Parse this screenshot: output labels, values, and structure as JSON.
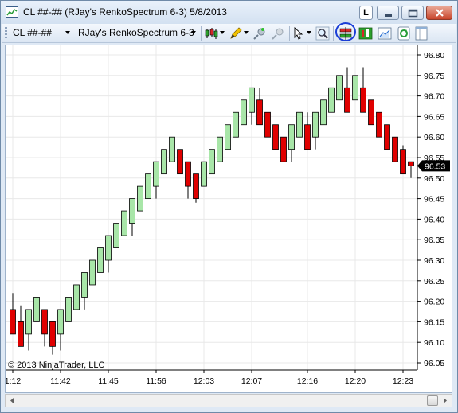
{
  "window": {
    "title": "CL ##-## (RJay's RenkoSpectrum 6-3)  5/8/2013",
    "lock_label": "L"
  },
  "toolbar": {
    "instrument": "CL ##-##",
    "chart_style": "RJay's RenkoSpectrum 6-3",
    "icons": [
      "candlestick-icon",
      "pencil-icon",
      "pin-icon",
      "magnet-icon",
      "cursor-icon",
      "zoom-icon",
      "bar-style-icon",
      "data-box-icon",
      "chart-properties-icon",
      "refresh-icon",
      "window-icon"
    ]
  },
  "copyright": "© 2013 NinjaTrader, LLC",
  "colors": {
    "up": "#a8e6a8",
    "down": "#e00000",
    "grid": "#e8e8e8",
    "circle": "#1a3dd6"
  },
  "chart_data": {
    "type": "candlestick",
    "price_tag": "96.53",
    "ylim": [
      96.05,
      96.82
    ],
    "yticks": [
      "96.80",
      "96.75",
      "96.70",
      "96.65",
      "96.60",
      "96.55",
      "96.50",
      "96.45",
      "96.40",
      "96.35",
      "96.30",
      "96.25",
      "96.20",
      "96.15",
      "96.10",
      "96.05"
    ],
    "xticks": [
      "1:12",
      "11:42",
      "11:45",
      "11:56",
      "12:03",
      "12:07",
      "12:16",
      "12:20",
      "12:23"
    ],
    "bars": [
      {
        "dir": "down",
        "open": 96.18,
        "close": 96.12,
        "high": 96.22,
        "low": 96.12
      },
      {
        "dir": "down",
        "open": 96.15,
        "close": 96.09,
        "high": 96.19,
        "low": 96.09
      },
      {
        "dir": "up",
        "open": 96.12,
        "close": 96.18,
        "high": 96.18,
        "low": 96.08
      },
      {
        "dir": "up",
        "open": 96.15,
        "close": 96.21,
        "high": 96.21,
        "low": 96.15
      },
      {
        "dir": "down",
        "open": 96.18,
        "close": 96.12,
        "high": 96.18,
        "low": 96.09
      },
      {
        "dir": "down",
        "open": 96.15,
        "close": 96.09,
        "high": 96.15,
        "low": 96.07
      },
      {
        "dir": "up",
        "open": 96.12,
        "close": 96.18,
        "high": 96.18,
        "low": 96.08
      },
      {
        "dir": "up",
        "open": 96.15,
        "close": 96.21,
        "high": 96.21,
        "low": 96.15
      },
      {
        "dir": "up",
        "open": 96.18,
        "close": 96.24,
        "high": 96.24,
        "low": 96.18
      },
      {
        "dir": "up",
        "open": 96.21,
        "close": 96.27,
        "high": 96.27,
        "low": 96.18
      },
      {
        "dir": "up",
        "open": 96.24,
        "close": 96.3,
        "high": 96.3,
        "low": 96.24
      },
      {
        "dir": "up",
        "open": 96.27,
        "close": 96.33,
        "high": 96.33,
        "low": 96.27
      },
      {
        "dir": "up",
        "open": 96.3,
        "close": 96.36,
        "high": 96.36,
        "low": 96.27
      },
      {
        "dir": "up",
        "open": 96.33,
        "close": 96.39,
        "high": 96.39,
        "low": 96.33
      },
      {
        "dir": "up",
        "open": 96.36,
        "close": 96.42,
        "high": 96.42,
        "low": 96.36
      },
      {
        "dir": "up",
        "open": 96.39,
        "close": 96.45,
        "high": 96.45,
        "low": 96.36
      },
      {
        "dir": "up",
        "open": 96.42,
        "close": 96.48,
        "high": 96.48,
        "low": 96.42
      },
      {
        "dir": "up",
        "open": 96.45,
        "close": 96.51,
        "high": 96.51,
        "low": 96.45
      },
      {
        "dir": "up",
        "open": 96.48,
        "close": 96.54,
        "high": 96.54,
        "low": 96.45
      },
      {
        "dir": "up",
        "open": 96.51,
        "close": 96.57,
        "high": 96.57,
        "low": 96.51
      },
      {
        "dir": "up",
        "open": 96.54,
        "close": 96.6,
        "high": 96.6,
        "low": 96.54
      },
      {
        "dir": "down",
        "open": 96.57,
        "close": 96.51,
        "high": 96.57,
        "low": 96.51
      },
      {
        "dir": "down",
        "open": 96.54,
        "close": 96.48,
        "high": 96.54,
        "low": 96.45
      },
      {
        "dir": "down",
        "open": 96.51,
        "close": 96.45,
        "high": 96.51,
        "low": 96.44
      },
      {
        "dir": "up",
        "open": 96.48,
        "close": 96.54,
        "high": 96.54,
        "low": 96.48
      },
      {
        "dir": "up",
        "open": 96.51,
        "close": 96.57,
        "high": 96.57,
        "low": 96.51
      },
      {
        "dir": "up",
        "open": 96.54,
        "close": 96.6,
        "high": 96.6,
        "low": 96.54
      },
      {
        "dir": "up",
        "open": 96.57,
        "close": 96.63,
        "high": 96.63,
        "low": 96.57
      },
      {
        "dir": "up",
        "open": 96.6,
        "close": 96.66,
        "high": 96.66,
        "low": 96.6
      },
      {
        "dir": "up",
        "open": 96.63,
        "close": 96.69,
        "high": 96.69,
        "low": 96.63
      },
      {
        "dir": "up",
        "open": 96.66,
        "close": 96.72,
        "high": 96.72,
        "low": 96.63
      },
      {
        "dir": "down",
        "open": 96.69,
        "close": 96.63,
        "high": 96.72,
        "low": 96.63
      },
      {
        "dir": "down",
        "open": 96.66,
        "close": 96.6,
        "high": 96.66,
        "low": 96.6
      },
      {
        "dir": "down",
        "open": 96.63,
        "close": 96.57,
        "high": 96.63,
        "low": 96.57
      },
      {
        "dir": "down",
        "open": 96.6,
        "close": 96.54,
        "high": 96.6,
        "low": 96.54
      },
      {
        "dir": "up",
        "open": 96.57,
        "close": 96.63,
        "high": 96.63,
        "low": 96.54
      },
      {
        "dir": "up",
        "open": 96.6,
        "close": 96.66,
        "high": 96.66,
        "low": 96.6
      },
      {
        "dir": "down",
        "open": 96.63,
        "close": 96.57,
        "high": 96.66,
        "low": 96.57
      },
      {
        "dir": "up",
        "open": 96.6,
        "close": 96.66,
        "high": 96.66,
        "low": 96.57
      },
      {
        "dir": "up",
        "open": 96.63,
        "close": 96.69,
        "high": 96.69,
        "low": 96.63
      },
      {
        "dir": "up",
        "open": 96.66,
        "close": 96.72,
        "high": 96.72,
        "low": 96.66
      },
      {
        "dir": "up",
        "open": 96.69,
        "close": 96.75,
        "high": 96.75,
        "low": 96.69
      },
      {
        "dir": "down",
        "open": 96.72,
        "close": 96.66,
        "high": 96.77,
        "low": 96.66
      },
      {
        "dir": "up",
        "open": 96.69,
        "close": 96.75,
        "high": 96.75,
        "low": 96.69
      },
      {
        "dir": "down",
        "open": 96.72,
        "close": 96.66,
        "high": 96.77,
        "low": 96.66
      },
      {
        "dir": "down",
        "open": 96.69,
        "close": 96.63,
        "high": 96.69,
        "low": 96.63
      },
      {
        "dir": "down",
        "open": 96.66,
        "close": 96.6,
        "high": 96.66,
        "low": 96.6
      },
      {
        "dir": "down",
        "open": 96.63,
        "close": 96.57,
        "high": 96.63,
        "low": 96.57
      },
      {
        "dir": "down",
        "open": 96.6,
        "close": 96.54,
        "high": 96.6,
        "low": 96.54
      },
      {
        "dir": "down",
        "open": 96.57,
        "close": 96.51,
        "high": 96.58,
        "low": 96.51
      },
      {
        "dir": "down",
        "open": 96.54,
        "close": 96.53,
        "high": 96.54,
        "low": 96.5
      }
    ]
  }
}
